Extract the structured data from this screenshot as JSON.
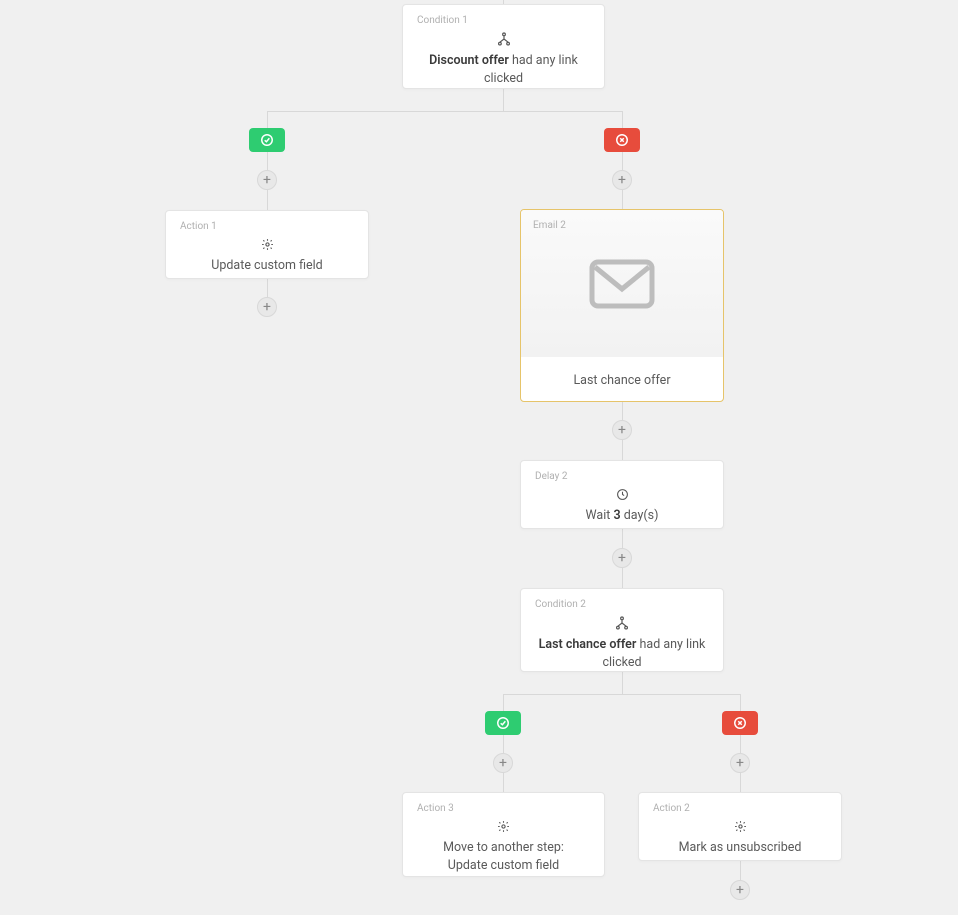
{
  "condition1": {
    "label": "Condition 1",
    "subject": "Discount offer",
    "predicate": " had any link clicked"
  },
  "action1": {
    "label": "Action 1",
    "text": "Update custom field"
  },
  "email2": {
    "label": "Email 2",
    "title": "Last chance offer"
  },
  "delay2": {
    "label": "Delay 2",
    "prefix": "Wait ",
    "value": "3",
    "suffix": " day(s)"
  },
  "condition2": {
    "label": "Condition 2",
    "subject": "Last chance offer",
    "predicate": " had any link clicked"
  },
  "action3": {
    "label": "Action 3",
    "line1": "Move to another step:",
    "line2": "Update custom field"
  },
  "action2": {
    "label": "Action 2",
    "text": "Mark as unsubscribed"
  },
  "icons": {
    "condition": "condition-icon",
    "action": "gear-icon",
    "email": "envelope-icon",
    "delay": "clock-icon",
    "yes": "check-circle-icon",
    "no": "x-circle-icon",
    "plus": "+"
  }
}
